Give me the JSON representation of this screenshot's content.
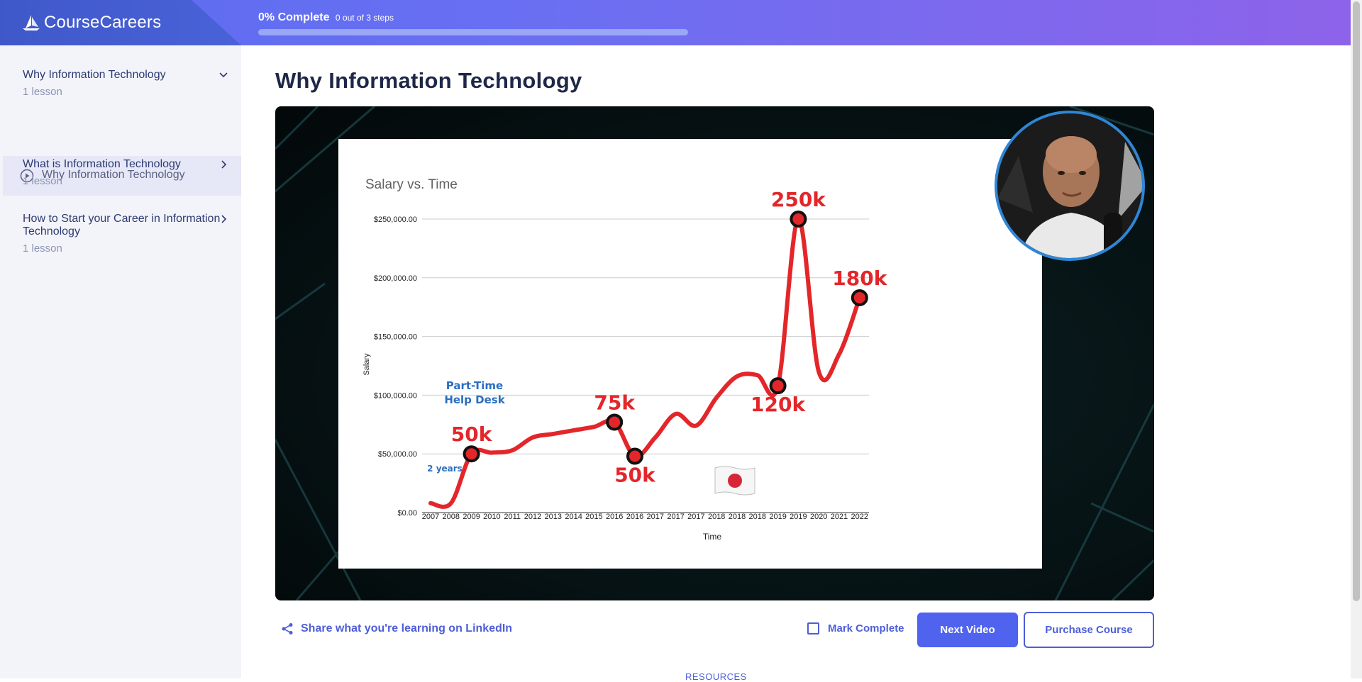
{
  "header": {
    "brand": "CourseCareers",
    "progress_percent_label": "0% Complete",
    "progress_steps_label": "0 out of 3 steps",
    "progress_fraction": 0.0
  },
  "sidebar": {
    "sections": [
      {
        "title": "Why Information Technology",
        "subtitle": "1 lesson",
        "expanded": true,
        "lessons": [
          {
            "label": "Why Information Technology",
            "active": true
          }
        ]
      },
      {
        "title": "What is Information Technology",
        "subtitle": "1 lesson",
        "expanded": false
      },
      {
        "title": "How to Start your Career in Information Technology",
        "subtitle": "1 lesson",
        "expanded": false
      }
    ]
  },
  "main": {
    "title": "Why Information Technology",
    "share_label": "Share what you're learning on LinkedIn",
    "mark_complete_label": "Mark Complete",
    "next_label": "Next Video",
    "purchase_label": "Purchase Course",
    "resources_label": "RESOURCES"
  },
  "chart_data": {
    "type": "line",
    "title": "Salary vs. Time",
    "xlabel": "Time",
    "ylabel": "Salary",
    "categories": [
      "2007",
      "2008",
      "2009",
      "2010",
      "2011",
      "2012",
      "2013",
      "2014",
      "2015",
      "2016",
      "2016",
      "2017",
      "2017",
      "2017",
      "2018",
      "2018",
      "2018",
      "2019",
      "2019",
      "2020",
      "2021",
      "2022"
    ],
    "yticks": [
      "$0.00",
      "$50,000.00",
      "$100,000.00",
      "$150,000.00",
      "$200,000.00",
      "$250,000.00"
    ],
    "ylim": [
      0,
      250000
    ],
    "values": [
      8000,
      8000,
      50000,
      51000,
      53000,
      64000,
      67000,
      70000,
      73000,
      77000,
      48000,
      64000,
      84000,
      74000,
      98000,
      116000,
      117000,
      108000,
      250000,
      120000,
      135000,
      183000
    ],
    "line_color": "#e3262a",
    "markers": [
      {
        "index": 2,
        "label": "50k"
      },
      {
        "index": 9,
        "label": "75k"
      },
      {
        "index": 10,
        "label": "50k"
      },
      {
        "index": 17,
        "label": "120k"
      },
      {
        "index": 18,
        "label": "250k"
      },
      {
        "index": 21,
        "label": "180k"
      }
    ],
    "annotations": [
      {
        "text": "Part-Time",
        "color": "#2a6ebf"
      },
      {
        "text": "Help Desk",
        "color": "#2a6ebf"
      },
      {
        "text": "2 years",
        "color": "#2a6ebf"
      }
    ],
    "grid": true,
    "legend": "none"
  },
  "colors": {
    "accent": "#4f63ee",
    "sidebar_bg": "#f3f4f9",
    "chart_line": "#e3262a",
    "avatar_ring": "#2f86d6"
  }
}
